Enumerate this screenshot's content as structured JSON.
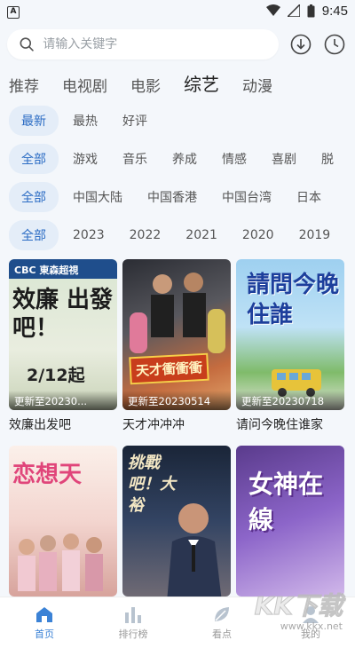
{
  "status_bar": {
    "app_badge": "A",
    "time": "9:45",
    "icons": [
      "wifi-icon",
      "signal-icon",
      "battery-icon"
    ]
  },
  "search": {
    "placeholder": "请输入关键字",
    "icons": [
      "search-icon",
      "download-icon",
      "history-icon"
    ]
  },
  "main_tabs": [
    {
      "label": "推荐",
      "active": false
    },
    {
      "label": "电视剧",
      "active": false
    },
    {
      "label": "电影",
      "active": false
    },
    {
      "label": "综艺",
      "active": true
    },
    {
      "label": "动漫",
      "active": false
    }
  ],
  "filters": {
    "sort": [
      "最新",
      "最热",
      "好评"
    ],
    "genre": [
      "全部",
      "游戏",
      "音乐",
      "养成",
      "情感",
      "喜剧",
      "脱"
    ],
    "region": [
      "全部",
      "中国大陆",
      "中国香港",
      "中国台湾",
      "日本"
    ],
    "year": [
      "全部",
      "2023",
      "2022",
      "2021",
      "2020",
      "2019"
    ]
  },
  "cards": [
    {
      "title": "效廉出发吧",
      "update": "更新至20230...",
      "poster_text": "效廉 出發吧！",
      "poster_sub": "2/12起",
      "channel": "CBC 東森超視"
    },
    {
      "title": "天才冲冲冲",
      "update": "更新至20230514",
      "poster_text": "天才衝衝衝"
    },
    {
      "title": "请问今晚住谁家",
      "update": "更新至20230718",
      "poster_text": "請問今晚住誰"
    },
    {
      "title": "",
      "update": "",
      "poster_text": "恋想天"
    },
    {
      "title": "",
      "update": "",
      "poster_text": "挑戰吧！大裕"
    },
    {
      "title": "",
      "update": "",
      "poster_text": "女神在線"
    }
  ],
  "bottom_nav": [
    {
      "label": "首页",
      "icon": "home-icon",
      "active": true
    },
    {
      "label": "排行榜",
      "icon": "bar-chart-icon",
      "active": false
    },
    {
      "label": "看点",
      "icon": "leaf-icon",
      "active": false
    },
    {
      "label": "我的",
      "icon": "user-icon",
      "active": false
    }
  ],
  "watermark": {
    "text": "KK下载",
    "url": "www.kkx.net"
  },
  "colors": {
    "accent": "#2b6cc4",
    "chip_bg": "#e4edf8",
    "background": "#f4f7fb"
  }
}
